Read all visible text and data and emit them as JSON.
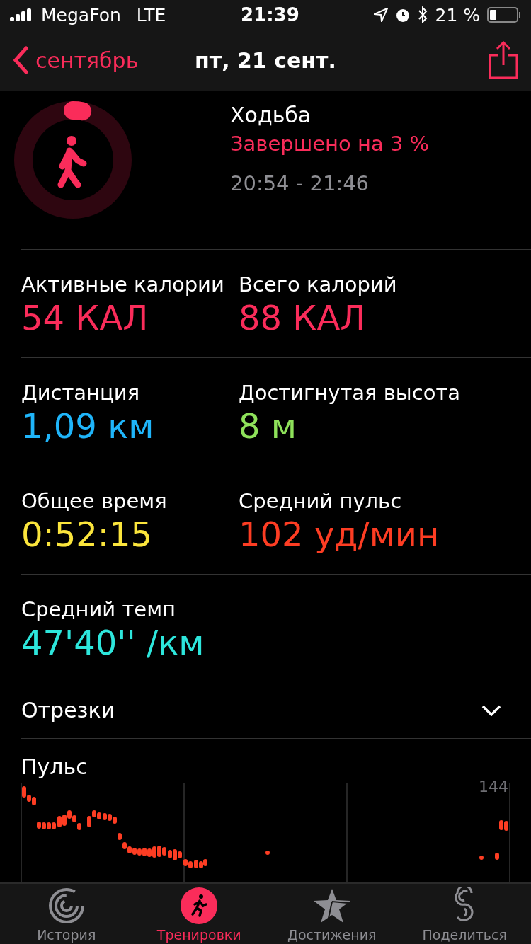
{
  "status_bar": {
    "carrier": "MegaFon",
    "network": "LTE",
    "time": "21:39",
    "battery": "21 %"
  },
  "nav": {
    "back": "сентябрь",
    "title": "пт, 21 сент."
  },
  "workout": {
    "name": "Ходьба",
    "progress_text": "Завершено на 3 %",
    "level": 0.03,
    "time_range": "20:54 - 21:46"
  },
  "metrics": [
    {
      "label": "Активные калории",
      "value": "54 КАЛ",
      "color": "#fa2c5a"
    },
    {
      "label": "Всего калорий",
      "value": "88 КАЛ",
      "color": "#fa2c5a"
    },
    {
      "label": "Дистанция",
      "value": "1,09 км",
      "color": "#1fb5fa"
    },
    {
      "label": "Достигнутая высота",
      "value": "8 м",
      "color": "#8ee15a"
    },
    {
      "label": "Общее время",
      "value": "0:52:15",
      "color": "#fbe53c"
    },
    {
      "label": "Средний пульс",
      "value": "102 уд/мин",
      "color": "#fd3d23"
    },
    {
      "label": "Средний темп",
      "value": "47'40'' /км",
      "color": "#2de6dc"
    }
  ],
  "splits": {
    "label": "Отрезки",
    "expanded": false
  },
  "pulse": {
    "title": "Пульс",
    "max_label": "144"
  },
  "tabs": [
    {
      "label": "История",
      "kind": "history",
      "selected": false
    },
    {
      "label": "Тренировки",
      "kind": "workouts",
      "selected": true
    },
    {
      "label": "Достижения",
      "kind": "awards",
      "selected": false
    },
    {
      "label": "Поделиться",
      "kind": "sharing",
      "selected": false
    }
  ]
}
